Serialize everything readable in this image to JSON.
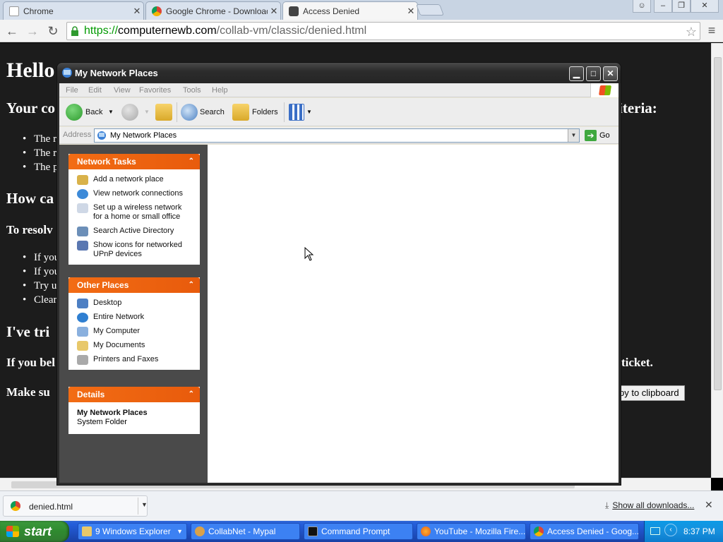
{
  "browser": {
    "tabs": [
      {
        "title": "Chrome",
        "active": false
      },
      {
        "title": "Google Chrome - Download t",
        "active": false
      },
      {
        "title": "Access Denied",
        "active": true
      }
    ],
    "url": {
      "scheme": "https://",
      "host": "computernewb.com",
      "path": "/collab-vm/classic/denied.html"
    }
  },
  "page": {
    "heading": "Hello",
    "line1": "Your co",
    "line1_end": "iteria:",
    "bullets1": [
      "The r",
      "The r",
      "The p"
    ],
    "how_heading": "How ca",
    "resolve": "To resolv",
    "bullets2": [
      "If you",
      "If you",
      "Try u",
      "Clear"
    ],
    "tried_heading": "I've tri",
    "believe": "If you bel",
    "believe_end": "ticket.",
    "make_sure": "Make su",
    "clipboard_button": "py to clipboard"
  },
  "explorer": {
    "title": "My Network Places",
    "menu": [
      "File",
      "Edit",
      "View",
      "Favorites",
      "Tools",
      "Help"
    ],
    "toolbar": {
      "back": "Back",
      "search": "Search",
      "folders": "Folders"
    },
    "address_label": "Address",
    "address_value": "My Network Places",
    "go_label": "Go",
    "network_tasks": {
      "title": "Network Tasks",
      "items": [
        "Add a network place",
        "View network connections",
        "Set up a wireless network for a home or small office",
        "Search Active Directory",
        "Show icons for networked UPnP devices"
      ]
    },
    "other_places": {
      "title": "Other Places",
      "items": [
        "Desktop",
        "Entire Network",
        "My Computer",
        "My Documents",
        "Printers and Faxes"
      ]
    },
    "details": {
      "title": "Details",
      "name": "My Network Places",
      "type": "System Folder"
    }
  },
  "downloads": {
    "file": "denied.html",
    "show_all": "Show all downloads..."
  },
  "taskbar": {
    "start": "start",
    "buttons": [
      {
        "label": "9 Windows Explorer",
        "active": false
      },
      {
        "label": "CollabNet - Mypal",
        "active": false
      },
      {
        "label": "Command Prompt",
        "active": false
      },
      {
        "label": "YouTube - Mozilla Fire...",
        "active": false
      },
      {
        "label": "Access Denied - Goog...",
        "active": false
      }
    ],
    "clock": "8:37 PM"
  }
}
